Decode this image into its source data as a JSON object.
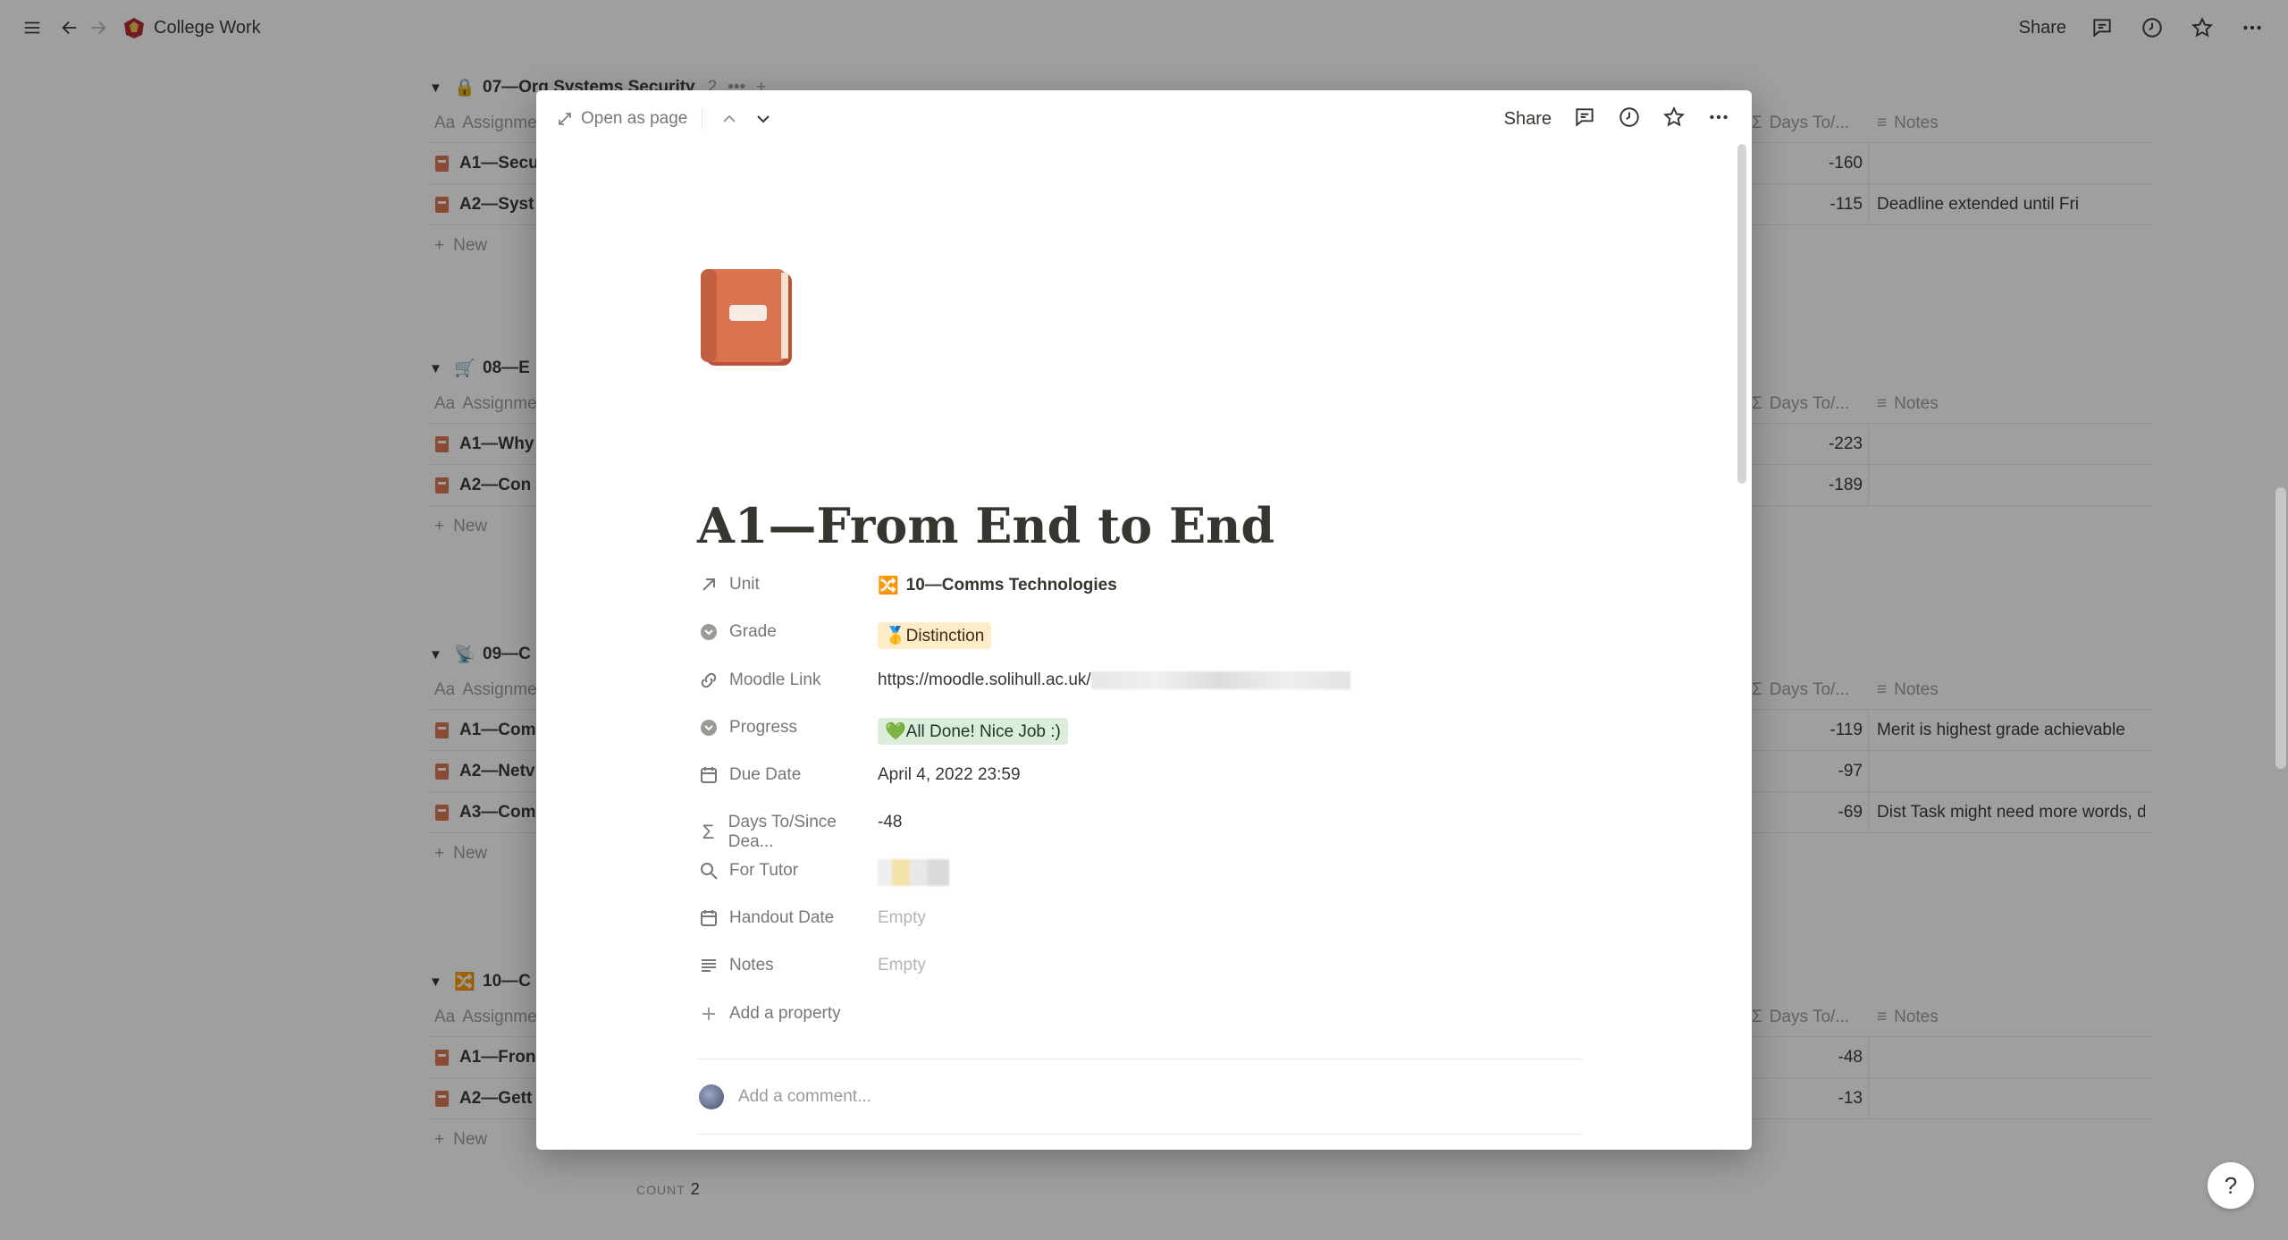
{
  "app": {
    "breadcrumb": "College Work",
    "share_label": "Share"
  },
  "groups": [
    {
      "title": "07—Org Systems Security",
      "count": "2",
      "rows": [
        {
          "name": "A1—Secu",
          "days": "-160",
          "note": ""
        },
        {
          "name": "A2—Syst",
          "days": "-115",
          "note": "Deadline extended until Fri"
        }
      ]
    },
    {
      "title": "08—E",
      "count": "",
      "rows": [
        {
          "name": "A1—Why",
          "days": "-223",
          "note": ""
        },
        {
          "name": "A2—Con",
          "days": "-189",
          "note": ""
        }
      ]
    },
    {
      "title": "09—C",
      "count": "",
      "rows": [
        {
          "name": "A1—Com",
          "days": "-119",
          "note": "Merit is highest grade achievable"
        },
        {
          "name": "A2—Netv",
          "days": "-97",
          "note": ""
        },
        {
          "name": "A3—Com",
          "days": "-69",
          "note": "Dist Task might need more words, d"
        }
      ]
    },
    {
      "title": "10—C",
      "count": "",
      "rows": [
        {
          "name": "A1—Fron",
          "days": "-48",
          "note": ""
        },
        {
          "name": "A2—Gett",
          "days": "-13",
          "note": ""
        }
      ]
    }
  ],
  "table": {
    "col_name": "Assignme",
    "col_days": "Days To/...",
    "col_notes": "Notes",
    "new_label": "New",
    "count_label": "COUNT",
    "count_value": "2"
  },
  "modal": {
    "open_as_page": "Open as page",
    "share_label": "Share",
    "title": "A1—From End to End",
    "properties": {
      "unit": {
        "label": "Unit",
        "value": "10—Comms Technologies"
      },
      "grade": {
        "label": "Grade",
        "value": "🥇Distinction"
      },
      "moodle": {
        "label": "Moodle Link",
        "value": "https://moodle.solihull.ac.uk/"
      },
      "progress": {
        "label": "Progress",
        "value": "💚All Done! Nice Job :)"
      },
      "due": {
        "label": "Due Date",
        "value": "April 4, 2022 23:59"
      },
      "days": {
        "label": "Days To/Since Dea...",
        "value": "-48"
      },
      "tutor": {
        "label": "For Tutor"
      },
      "handout": {
        "label": "Handout Date",
        "value": "Empty"
      },
      "notes": {
        "label": "Notes",
        "value": "Empty"
      }
    },
    "add_property": "Add a property",
    "comment_placeholder": "Add a comment..."
  },
  "help_label": "?",
  "colors": {
    "overlay": "#0f0f0f66",
    "tag_yellow": "#fdecc8",
    "tag_green": "#dbeddb",
    "book_icon": "#d9734f"
  }
}
